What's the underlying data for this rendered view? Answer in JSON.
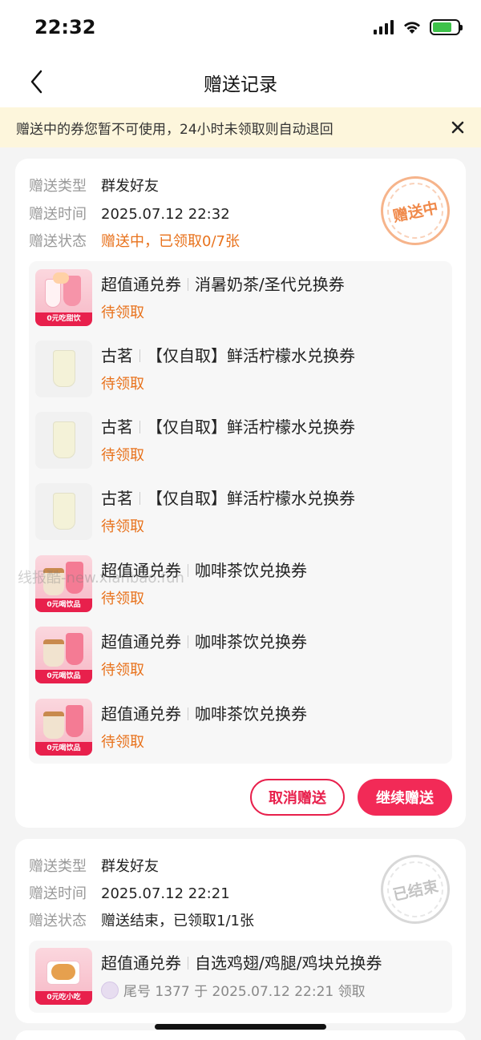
{
  "status_bar": {
    "time": "22:32"
  },
  "nav": {
    "title": "赠送记录"
  },
  "notice": {
    "text": "赠送中的券您暂不可使用，24小时未领取则自动退回"
  },
  "labels": {
    "type": "赠送类型",
    "time": "赠送时间",
    "status": "赠送状态"
  },
  "records": [
    {
      "type": "群发好友",
      "time": "2025.07.12 22:32",
      "status": "赠送中，已领取0/7张",
      "stamp": "赠送中",
      "coupons": [
        {
          "brand": "超值通兑券",
          "name": "消暑奶茶/圣代兑换券",
          "status": "待领取",
          "thumb_label": "0元吃甜饮"
        },
        {
          "brand": "古茗",
          "name": "【仅自取】鲜活柠檬水兑换券",
          "status": "待领取",
          "thumb_label": ""
        },
        {
          "brand": "古茗",
          "name": "【仅自取】鲜活柠檬水兑换券",
          "status": "待领取",
          "thumb_label": ""
        },
        {
          "brand": "古茗",
          "name": "【仅自取】鲜活柠檬水兑换券",
          "status": "待领取",
          "thumb_label": ""
        },
        {
          "brand": "超值通兑券",
          "name": "咖啡茶饮兑换券",
          "status": "待领取",
          "thumb_label": "0元喝饮品"
        },
        {
          "brand": "超值通兑券",
          "name": "咖啡茶饮兑换券",
          "status": "待领取",
          "thumb_label": "0元喝饮品"
        },
        {
          "brand": "超值通兑券",
          "name": "咖啡茶饮兑换券",
          "status": "待领取",
          "thumb_label": "0元喝饮品"
        }
      ],
      "cancel_label": "取消赠送",
      "continue_label": "继续赠送"
    },
    {
      "type": "群发好友",
      "time": "2025.07.12 22:21",
      "status": "赠送结束，已领取1/1张",
      "stamp": "已结束",
      "coupons": [
        {
          "brand": "超值通兑券",
          "name": "自选鸡翅/鸡腿/鸡块兑换券",
          "status": "尾号 1377 于 2025.07.12 22:21 领取",
          "thumb_label": "0元吃小吃"
        }
      ]
    }
  ],
  "watermark": "线报酷-new.xianbao.fun",
  "colors": {
    "accent": "#f22a57",
    "pending": "#e8721c",
    "notice_bg": "#fdf6dc"
  }
}
